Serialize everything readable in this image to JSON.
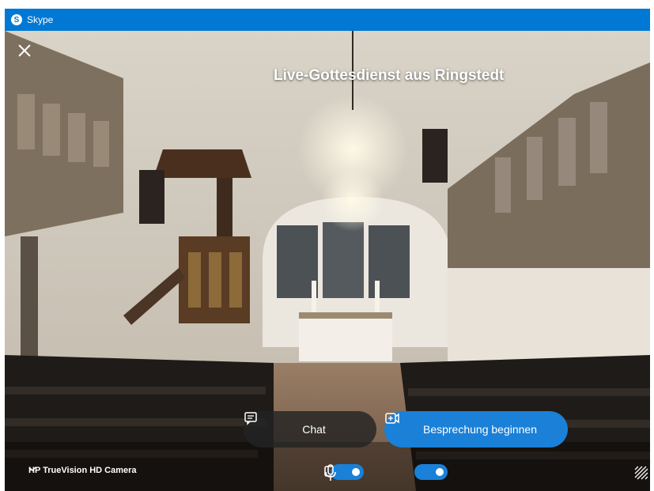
{
  "app": {
    "title": "Skype",
    "logo_letter": "S"
  },
  "meeting": {
    "title": "Live-Gottesdienst aus Ringstedt"
  },
  "actions": {
    "chat_label": "Chat",
    "start_label": "Besprechung beginnen"
  },
  "devices": {
    "camera_name": "HP TrueVision HD Camera",
    "video_enabled": true,
    "audio_enabled": true
  },
  "icons": {
    "close": "close-icon",
    "chat": "chat-icon",
    "start": "video-start-icon",
    "chevron": "chevron-down-icon",
    "video": "video-camera-icon",
    "mic": "microphone-icon",
    "effects": "background-effects-icon"
  },
  "colors": {
    "titlebar": "#0078d4",
    "accent": "#1a80d8"
  }
}
